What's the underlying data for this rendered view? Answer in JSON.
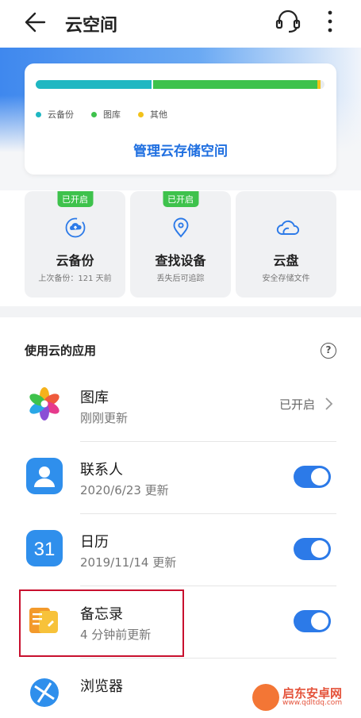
{
  "header": {
    "title": "云空间",
    "back_icon": "back-arrow-icon",
    "support_icon": "headset-icon",
    "more_icon": "more-vertical-icon"
  },
  "storage": {
    "usage": {
      "backup": 0.4,
      "gallery": 0.57,
      "other": 0.01
    },
    "legend": [
      {
        "label": "云备份",
        "color": "#1fb7c2"
      },
      {
        "label": "图库",
        "color": "#3ec24c"
      },
      {
        "label": "其他",
        "color": "#f2c21a"
      }
    ],
    "manage_label": "管理云存储空间"
  },
  "features": [
    {
      "badge": "已开启",
      "title": "云备份",
      "subtitle": "上次备份：121 天前",
      "icon": "cloud-backup-icon"
    },
    {
      "badge": "已开启",
      "title": "查找设备",
      "subtitle": "丢失后可追踪",
      "icon": "location-pin-icon"
    },
    {
      "badge": "",
      "title": "云盘",
      "subtitle": "安全存储文件",
      "icon": "cloud-drive-icon"
    }
  ],
  "apps_section": {
    "title": "使用云的应用",
    "help_icon": "help-icon",
    "help_glyph": "?"
  },
  "apps": [
    {
      "name": "图库",
      "subtitle": "刚刚更新",
      "status": "已开启",
      "icon": "gallery-icon"
    },
    {
      "name": "联系人",
      "subtitle": "2020/6/23 更新",
      "enabled": true,
      "icon": "contacts-icon"
    },
    {
      "name": "日历",
      "subtitle": "2019/11/14 更新",
      "enabled": true,
      "icon": "calendar-icon",
      "icon_text": "31"
    },
    {
      "name": "备忘录",
      "subtitle": "4 分钟前更新",
      "enabled": true,
      "icon": "notepad-icon"
    },
    {
      "name": "浏览器",
      "subtitle": "",
      "icon": "browser-icon"
    }
  ],
  "watermark": {
    "title": "启东安卓网",
    "url": "www.qdltdq.com"
  },
  "colors": {
    "accent": "#2c7ae8",
    "enabled_badge": "#3ec24c",
    "highlight": "#c8102e"
  }
}
